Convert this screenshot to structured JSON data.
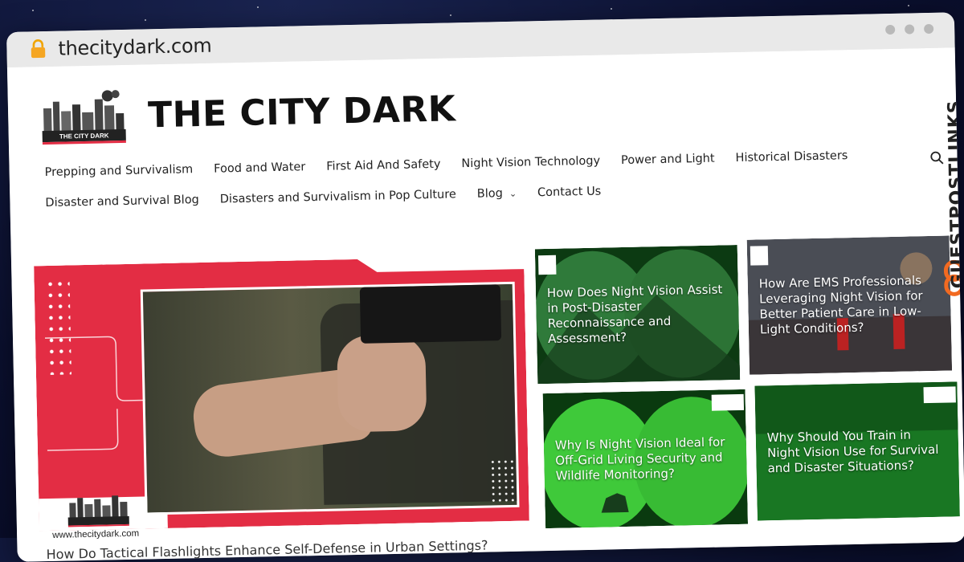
{
  "browser": {
    "url": "thecitydark.com"
  },
  "site": {
    "title": "THE CITY DARK",
    "logo_text": "THE CITY DARK"
  },
  "nav": {
    "row1": [
      {
        "label": "Prepping and Survivalism"
      },
      {
        "label": "Food and Water"
      },
      {
        "label": "First Aid And Safety"
      },
      {
        "label": "Night Vision Technology"
      },
      {
        "label": "Power and Light"
      },
      {
        "label": "Historical Disasters"
      }
    ],
    "row2": [
      {
        "label": "Disaster and Survival Blog"
      },
      {
        "label": "Disasters and Survivalism in Pop Culture"
      },
      {
        "label": "Blog"
      },
      {
        "label": "Contact Us"
      }
    ]
  },
  "featured": {
    "image_url_text": "www.thecitydark.com",
    "title": "How Do Tactical Flashlights Enhance Self-Defense in Urban Settings?"
  },
  "cards": [
    {
      "title": "How Does Night Vision Assist in Post-Disaster Reconnaissance and Assessment?"
    },
    {
      "title": "How Are EMS Professionals Leveraging Night Vision for Better Patient Care in Low-Light Conditions?"
    },
    {
      "title": "Why Is Night Vision Ideal for Off-Grid Living Security and Wildlife Monitoring?"
    },
    {
      "title": "Why Should You Train in Night Vision Use for Survival and Disaster Situations?"
    }
  ],
  "side_banner": {
    "text": "GUESTPOSTLINKS"
  },
  "colors": {
    "accent_red": "#e32d44",
    "night_green": "#1f8a2a",
    "banner_orange": "#f26a21"
  },
  "icons": {
    "lock": "lock-icon",
    "search": "search-icon",
    "chevron": "chevron-down-icon"
  }
}
